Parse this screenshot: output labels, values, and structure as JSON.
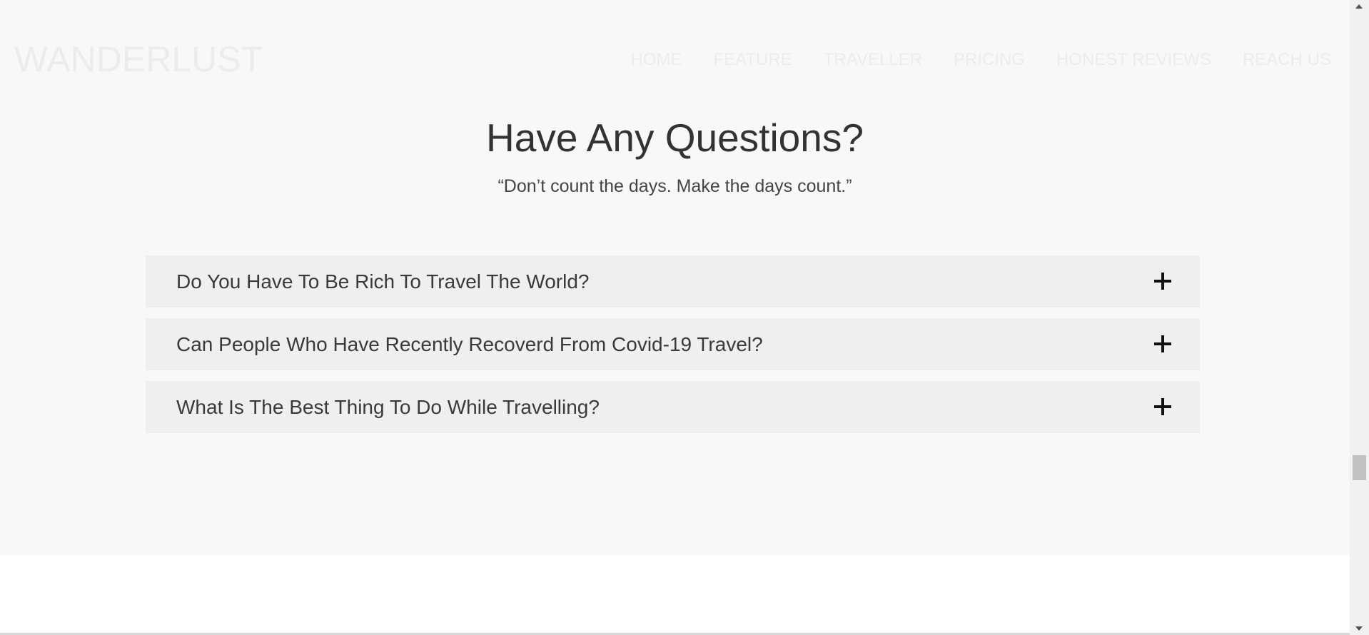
{
  "navbar": {
    "brand": "WANDERLUST",
    "items": [
      {
        "label": "HOME"
      },
      {
        "label": "FEATURE"
      },
      {
        "label": "TRAVELLER"
      },
      {
        "label": "PRICING"
      },
      {
        "label": "HONEST REVIEWS"
      },
      {
        "label": "REACH US"
      }
    ]
  },
  "faq": {
    "title": "Have Any Questions?",
    "subtitle": "“Don’t count the days. Make the days count.”",
    "items": [
      {
        "question": "Do You Have To Be Rich To Travel The World?",
        "icon": "plus-icon"
      },
      {
        "question": "Can People Who Have Recently Recoverd From Covid-19 Travel?",
        "icon": "plus-icon"
      },
      {
        "question": "What Is The Best Thing To Do While Travelling?",
        "icon": "plus-icon"
      }
    ]
  },
  "colors": {
    "section_background": "#f8f8f8",
    "faq_item_background": "#efefef",
    "nav_text": "#ececec",
    "heading_text": "#333333"
  }
}
